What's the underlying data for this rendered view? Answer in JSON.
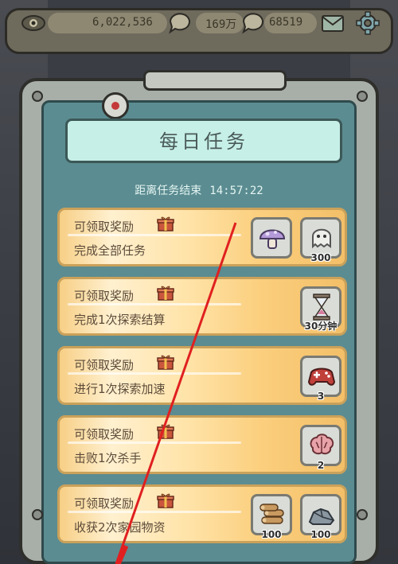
{
  "topbar": {
    "eye_value": "6,022,536",
    "currency_a": "169万",
    "currency_b": "68519"
  },
  "panel": {
    "title": "每日任务",
    "timer_label": "距离任务结束",
    "timer_value": "14:57:22"
  },
  "tasks": [
    {
      "claim": "可领取奖励",
      "desc": "完成全部任务",
      "rewards": [
        {
          "icon": "mushroom-icon",
          "qty": ""
        },
        {
          "icon": "ghost-icon",
          "qty": "300"
        }
      ]
    },
    {
      "claim": "可领取奖励",
      "desc": "完成1次探索结算",
      "rewards": [
        {
          "icon": "hourglass-icon",
          "qty": "30分钟"
        }
      ]
    },
    {
      "claim": "可领取奖励",
      "desc": "进行1次探索加速",
      "rewards": [
        {
          "icon": "gamepad-icon",
          "qty": "3"
        }
      ]
    },
    {
      "claim": "可领取奖励",
      "desc": "击败1次杀手",
      "rewards": [
        {
          "icon": "brain-icon",
          "qty": "2"
        }
      ]
    },
    {
      "claim": "可领取奖励",
      "desc": "收获2次家园物资",
      "rewards": [
        {
          "icon": "wood-logs-icon",
          "qty": "100"
        },
        {
          "icon": "stone-icon",
          "qty": "100"
        }
      ]
    }
  ],
  "colors": {
    "panel_teal": "#5b8c91",
    "card_orange": "#f7cf86",
    "annotation_red": "#e02020"
  }
}
